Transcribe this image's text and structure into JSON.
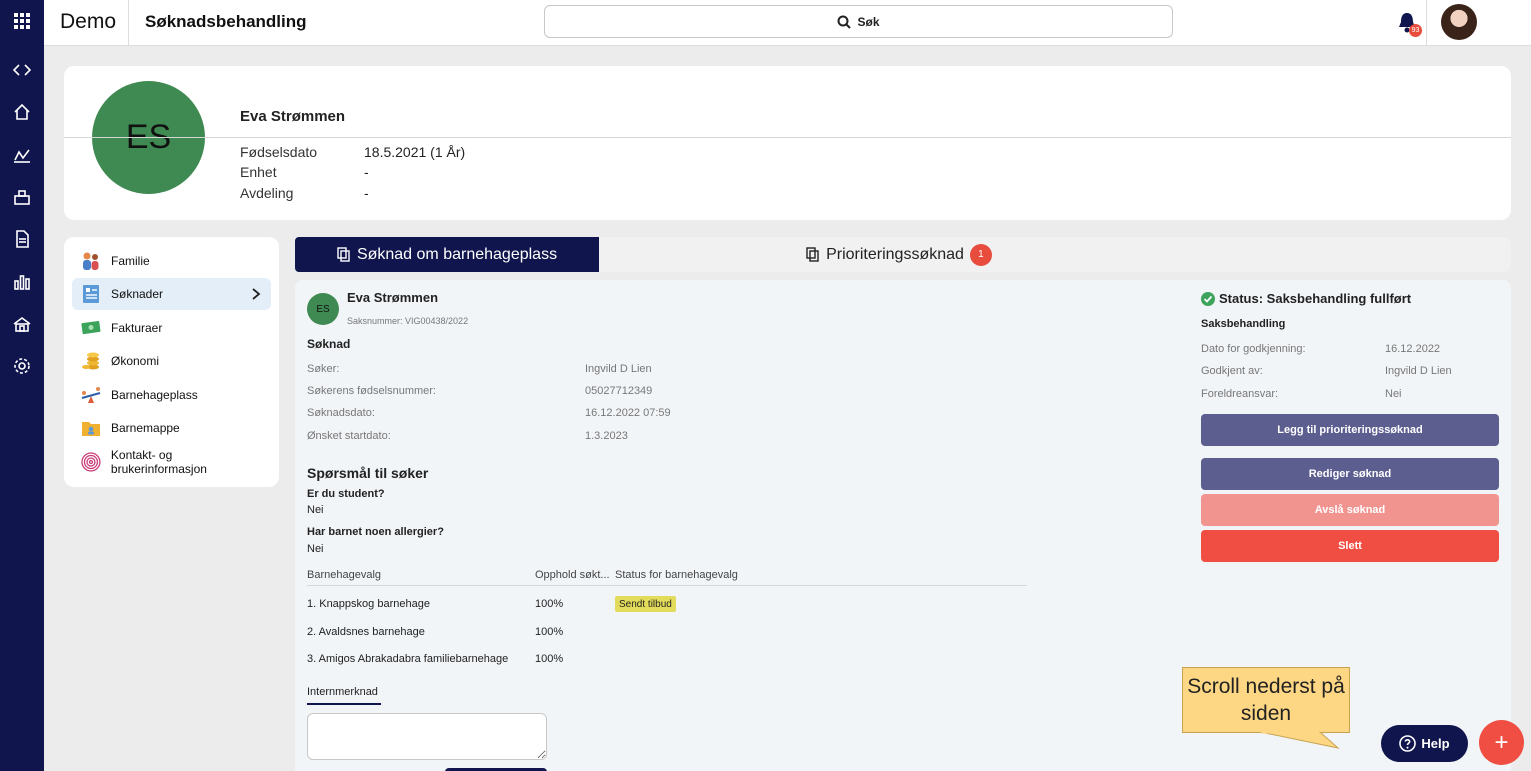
{
  "app": {
    "name": "Demo",
    "page_title": "Søknadsbehandling"
  },
  "search": {
    "label": "Søk"
  },
  "notifications": {
    "count": "93"
  },
  "colors": {
    "navy": "#10154d",
    "green": "#3f8a52",
    "red": "#f04e42",
    "purple": "#5c5e8f",
    "pink": "#f19490",
    "tag_yellow": "#e3dc5a"
  },
  "rail": {
    "icons": [
      "code-icon",
      "home-icon",
      "dashboard-icon",
      "building-icon",
      "document-icon",
      "chart-icon",
      "house-icon",
      "gear-icon"
    ]
  },
  "profile": {
    "initials": "ES",
    "name": "Eva Strømmen",
    "fields": [
      {
        "label": "Fødselsdato",
        "value": "18.5.2021 (1 År)"
      },
      {
        "label": "Enhet",
        "value": "-"
      },
      {
        "label": "Avdeling",
        "value": "-"
      }
    ]
  },
  "menu": {
    "items": [
      {
        "label": "Familie",
        "icon": "family-icon"
      },
      {
        "label": "Søknader",
        "icon": "application-icon",
        "active": true
      },
      {
        "label": "Fakturaer",
        "icon": "invoice-icon"
      },
      {
        "label": "Økonomi",
        "icon": "coins-icon"
      },
      {
        "label": "Barnehageplass",
        "icon": "seesaw-icon"
      },
      {
        "label": "Barnemappe",
        "icon": "folder-icon"
      },
      {
        "label": "Kontakt- og brukerinformasjon",
        "icon": "fingerprint-icon"
      }
    ]
  },
  "tabs": [
    {
      "label": "Søknad om barnehageplass",
      "active": true
    },
    {
      "label": "Prioriteringssøknad",
      "badge": "1"
    }
  ],
  "application": {
    "initials": "ES",
    "name": "Eva Strømmen",
    "case_number": "Saksnummer: VIG00438/2022",
    "section_title": "Søknad",
    "fields": [
      {
        "label": "Søker:",
        "value": "Ingvild D Lien"
      },
      {
        "label": "Søkerens fødselsnummer:",
        "value": "05027712349"
      },
      {
        "label": "Søknadsdato:",
        "value": "16.12.2022 07:59"
      },
      {
        "label": "Ønsket startdato:",
        "value": "1.3.2023"
      }
    ],
    "questions_title": "Spørsmål til søker",
    "questions": [
      {
        "q": "Er du student?",
        "a": "Nei"
      },
      {
        "q": "Har barnet noen allergier?",
        "a": "Nei"
      }
    ],
    "table": {
      "headers": [
        "Barnehagevalg",
        "Opphold søkt...",
        "Status for barnehagevalg"
      ],
      "rows": [
        {
          "name": "1. Knappskog barnehage",
          "stay": "100%",
          "status": "Sendt tilbud"
        },
        {
          "name": "2. Avaldsnes barnehage",
          "stay": "100%",
          "status": ""
        },
        {
          "name": "3. Amigos Abrakadabra familiebarnehage",
          "stay": "100%",
          "status": ""
        }
      ]
    },
    "note_tab": "Internmerknad"
  },
  "status_panel": {
    "status": "Status: Saksbehandling fullført",
    "subtitle": "Saksbehandling",
    "fields": [
      {
        "label": "Dato for godkjenning:",
        "value": "16.12.2022"
      },
      {
        "label": "Godkjent av:",
        "value": "Ingvild D Lien"
      },
      {
        "label": "Foreldreansvar:",
        "value": "Nei"
      }
    ],
    "buttons": {
      "add_priority": "Legg til prioriteringssøknad",
      "edit": "Rediger søknad",
      "reject": "Avslå søknad",
      "delete": "Slett"
    }
  },
  "tooltip": {
    "text": "Scroll nederst på siden"
  },
  "help": {
    "label": "Help"
  },
  "fab": {
    "label": "+"
  }
}
